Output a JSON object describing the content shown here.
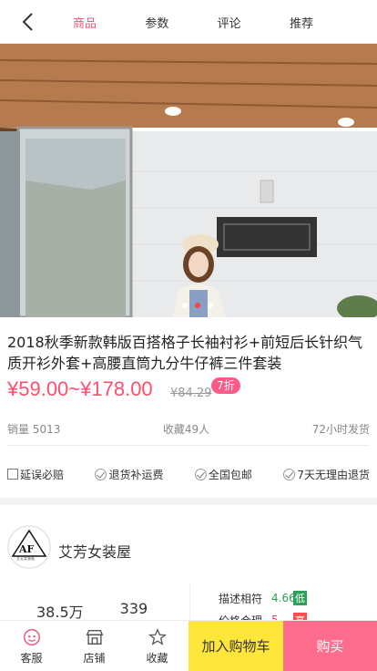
{
  "header": {
    "tabs": [
      {
        "label": "商品"
      },
      {
        "label": "参数"
      },
      {
        "label": "评论"
      },
      {
        "label": "推荐"
      }
    ]
  },
  "product": {
    "title": "2018秋季新款韩版百搭格子长袖衬衫+前短后长针织气质开衫外套+高腰直筒九分牛仔裤三件套装",
    "price": "¥59.00~¥178.00",
    "old_price": "¥84.29",
    "discount": "7折",
    "sales": "销量 5013",
    "favorites": "收藏49人",
    "shipping": "72小时发货",
    "badges": [
      "延误必赔",
      "退货补运费",
      "全国包邮",
      "7天无理由退货"
    ],
    "image_dots": {
      "count": 3,
      "active_index": 1
    }
  },
  "shop": {
    "name": "艾芳女装屋",
    "logo_text": "AF",
    "logo_subtext": "艾芳女装屋",
    "stat1": "38.5万",
    "stat2": "339",
    "ratings": [
      {
        "label": "描述相符",
        "value": "4.66",
        "tag": "低"
      },
      {
        "label": "价格合理",
        "value": "5",
        "tag": "高"
      }
    ]
  },
  "bottom": {
    "service": "客服",
    "store": "店铺",
    "favorite": "收藏",
    "add_to_cart": "加入购物车",
    "buy": "购买"
  },
  "colors": {
    "accent": "#e8577a",
    "price": "#ff4d6d",
    "cart": "#ffe63a",
    "buy": "#ff6d8e"
  }
}
